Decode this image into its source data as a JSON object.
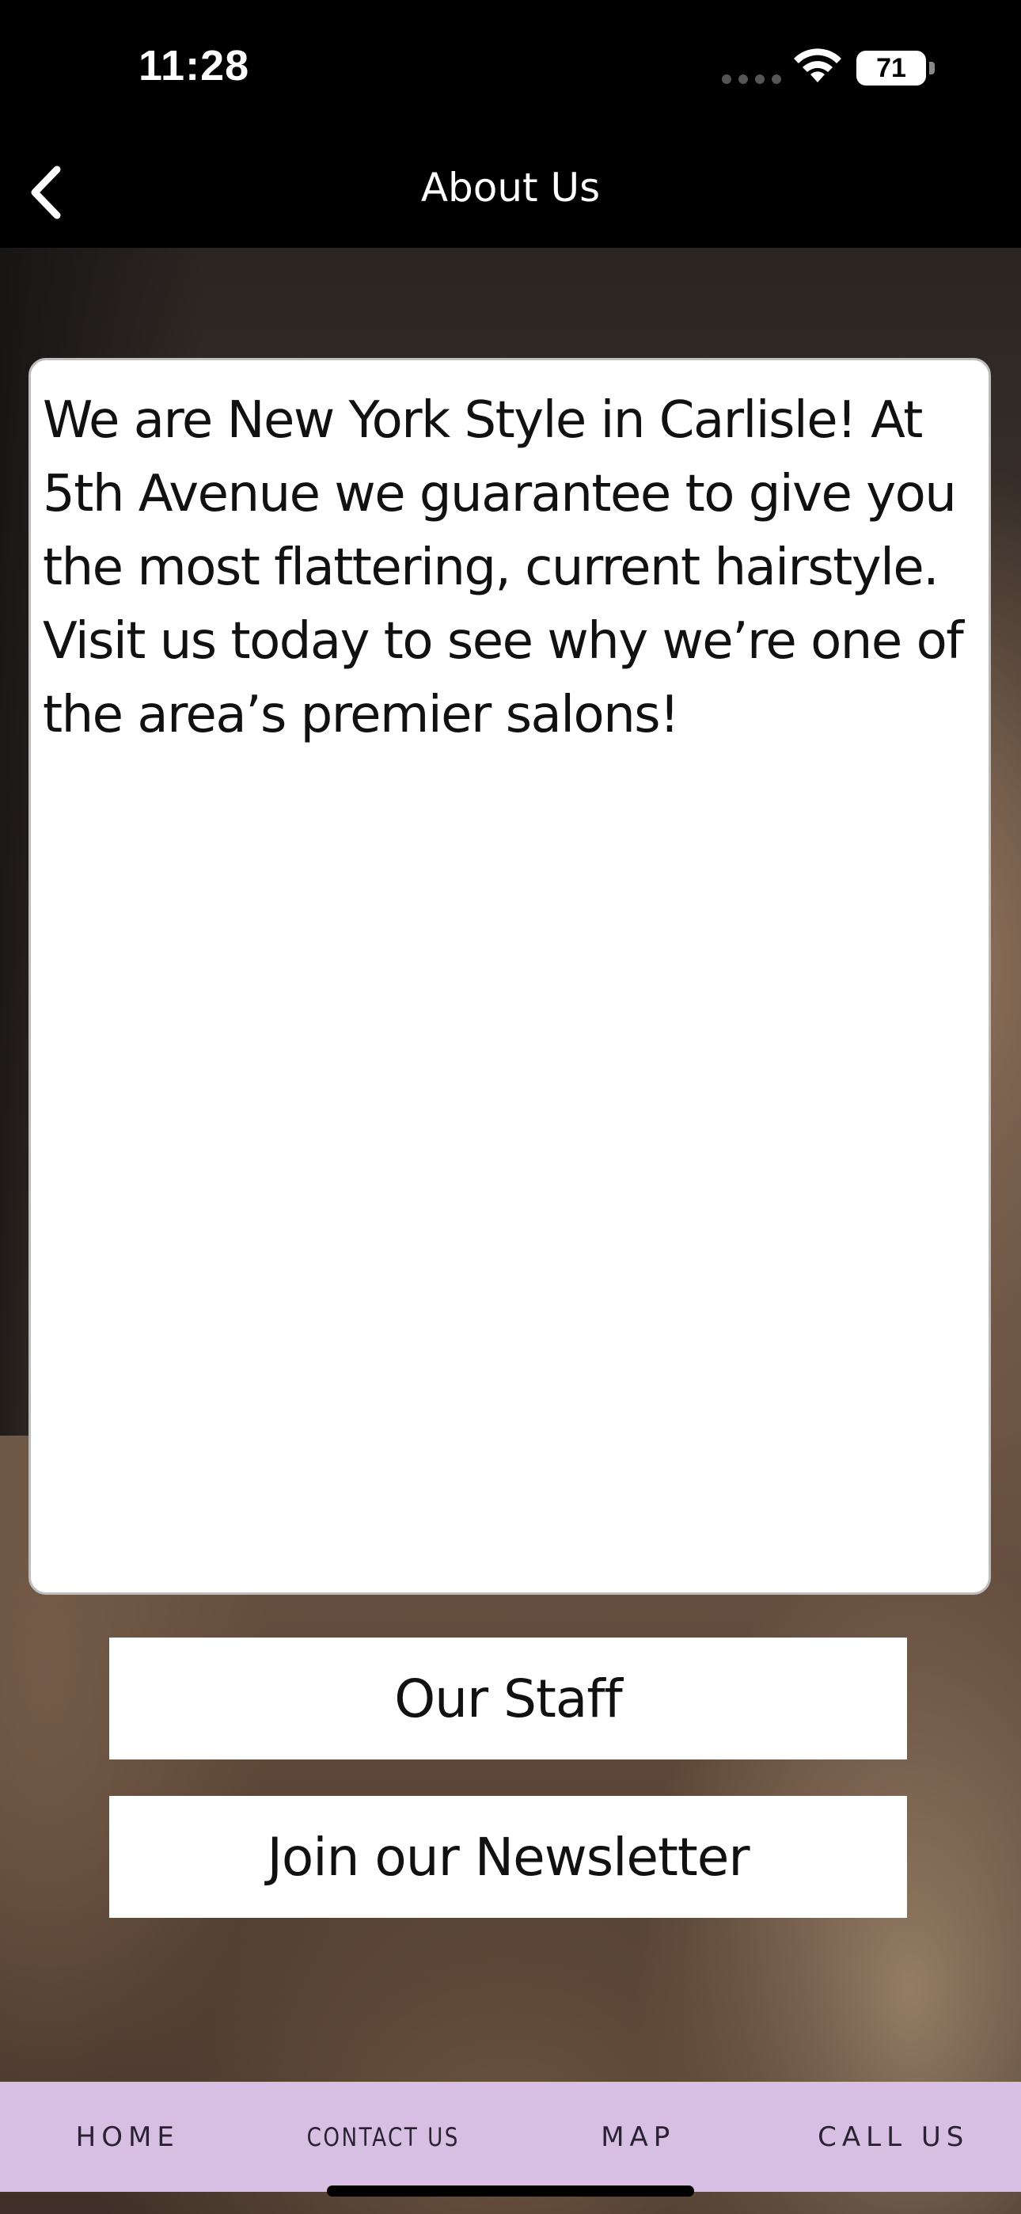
{
  "status_bar": {
    "time": "11:28",
    "battery": "71"
  },
  "nav": {
    "title": "About Us",
    "back_icon": "chevron-left-icon"
  },
  "about": {
    "text": "We are New York Style in Carlisle! At 5th Avenue we guarantee to give you the most flattering, current hairstyle. Visit us today to see why we’re one of the area’s premier salons!"
  },
  "buttons": {
    "staff_label": "Our Staff",
    "newsletter_label": "Join our Newsletter"
  },
  "tabs": [
    {
      "label": "HOME"
    },
    {
      "label": "CONTACT US"
    },
    {
      "label": "MAP"
    },
    {
      "label": "CALL US"
    }
  ],
  "colors": {
    "tab_bar_background": "#d6bfe3",
    "header_background": "#000000"
  }
}
